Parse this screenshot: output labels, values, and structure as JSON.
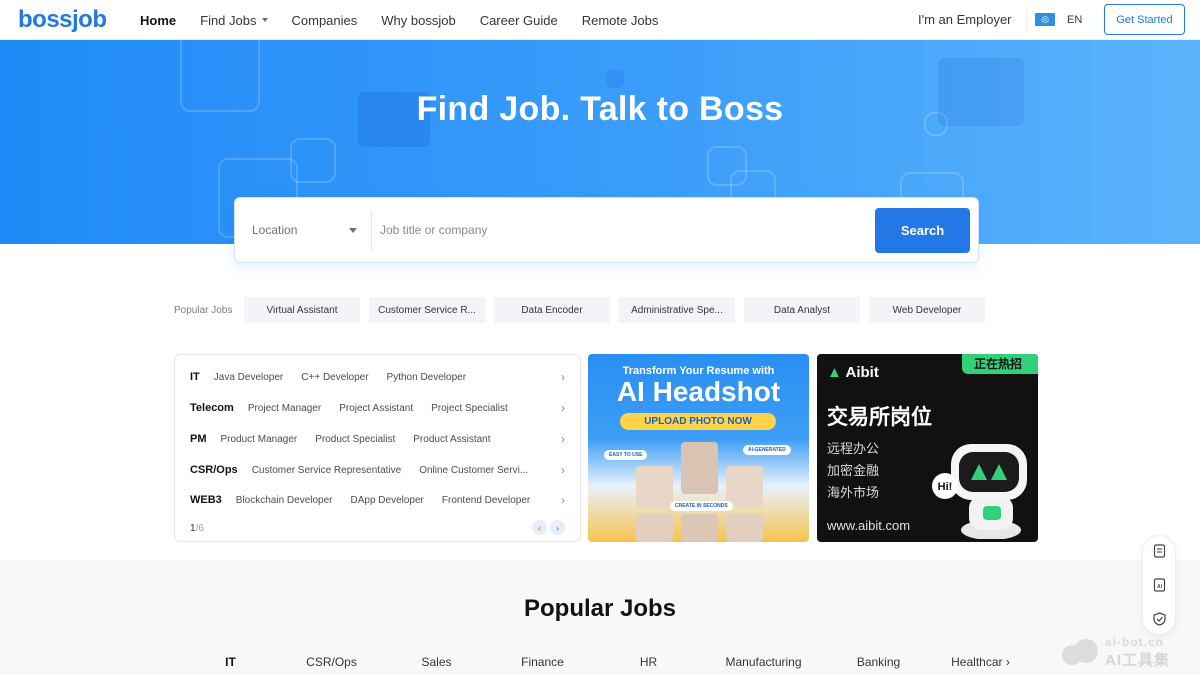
{
  "nav": {
    "logo": "bossjob",
    "items": [
      {
        "label": "Home"
      },
      {
        "label": "Find Jobs"
      },
      {
        "label": "Companies"
      },
      {
        "label": "Why bossjob"
      },
      {
        "label": "Career Guide"
      },
      {
        "label": "Remote Jobs"
      }
    ],
    "employer": "I'm an Employer",
    "lang": "EN",
    "get_started": "Get Started"
  },
  "hero": {
    "title": "Find Job. Talk to Boss"
  },
  "search": {
    "location": "Location",
    "placeholder": "Job title or company",
    "button": "Search"
  },
  "popular": {
    "label": "Popular Jobs",
    "chips": [
      "Virtual Assistant",
      "Customer Service R...",
      "Data Encoder",
      "Administrative Spe...",
      "Data Analyst",
      "Web Developer"
    ]
  },
  "categories": {
    "rows": [
      {
        "main": "IT",
        "subs": [
          "Java Developer",
          "C++ Developer",
          "Python Developer"
        ]
      },
      {
        "main": "Telecom",
        "subs": [
          "Project Manager",
          "Project Assistant",
          "Project Specialist"
        ]
      },
      {
        "main": "PM",
        "subs": [
          "Product Manager",
          "Product Specialist",
          "Product Assistant"
        ]
      },
      {
        "main": "CSR/Ops",
        "subs": [
          "Customer Service Representative",
          "Online Customer Servi..."
        ]
      },
      {
        "main": "WEB3",
        "subs": [
          "Blockchain Developer",
          "DApp Developer",
          "Frontend Developer"
        ]
      }
    ],
    "page": "1",
    "total": "/6"
  },
  "ad1": {
    "line1": "Transform Your Resume with",
    "line2": "AI Headshot",
    "pill": "UPLOAD PHOTO NOW",
    "tag1": "EASY TO USE",
    "tag2": "AI-GENERATED",
    "tag3": "CREATE IN SECONDS"
  },
  "ad2": {
    "brand": "Aibit",
    "hot": "正在热招",
    "headline": "交易所岗位",
    "lines": [
      "远程办公",
      "加密金融",
      "海外市场"
    ],
    "url": "www.aibit.com",
    "bubble": "Hi!"
  },
  "popular_section": {
    "title": "Popular Jobs",
    "tabs": [
      "IT",
      "CSR/Ops",
      "Sales",
      "Finance",
      "HR",
      "Manufacturing",
      "Banking",
      "Healthcar"
    ]
  },
  "watermark": {
    "line1": "ai-bot.cn",
    "line2": "AI工具集"
  }
}
